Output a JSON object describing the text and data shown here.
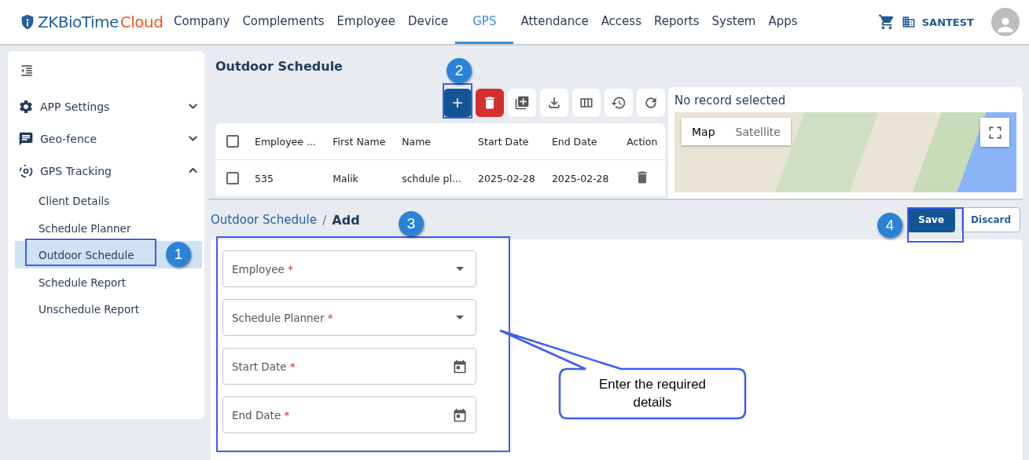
{
  "header": {
    "logo": {
      "brand": "ZKBioTime",
      "suffix": "Cloud"
    },
    "nav": [
      {
        "label": "Company",
        "selected": false
      },
      {
        "label": "Complements",
        "selected": false
      },
      {
        "label": "Employee",
        "selected": false
      },
      {
        "label": "Device",
        "selected": false
      },
      {
        "label": "GPS",
        "selected": true
      },
      {
        "label": "Attendance",
        "selected": false
      },
      {
        "label": "Access",
        "selected": false
      },
      {
        "label": "Reports",
        "selected": false
      },
      {
        "label": "System",
        "selected": false
      },
      {
        "label": "Apps",
        "selected": false
      }
    ],
    "company": "SANTEST"
  },
  "sidebar": {
    "items": [
      {
        "label": "APP Settings",
        "expanded": false
      },
      {
        "label": "Geo-fence",
        "expanded": false
      },
      {
        "label": "GPS Tracking",
        "expanded": true,
        "children": [
          {
            "label": "Client Details",
            "selected": false
          },
          {
            "label": "Schedule Planner",
            "selected": false
          },
          {
            "label": "Outdoor Schedule",
            "selected": true
          },
          {
            "label": "Schedule Report",
            "selected": false
          },
          {
            "label": "Unschedule Report",
            "selected": false
          }
        ]
      }
    ]
  },
  "list": {
    "title": "Outdoor Schedule",
    "table": {
      "select_all_checked": false,
      "columns": [
        "Employee ...",
        "First Name",
        "Name",
        "Start Date",
        "End Date",
        "Action"
      ],
      "rows": [
        {
          "checked": false,
          "cells": [
            "535",
            "Malik",
            "schdule pl...",
            "2025-02-28",
            "2025-02-28"
          ]
        }
      ]
    }
  },
  "map": {
    "status": "No record selected",
    "types": [
      {
        "label": "Map",
        "selected": true
      },
      {
        "label": "Satellite",
        "selected": false
      }
    ]
  },
  "form": {
    "breadcrumb": {
      "parent": "Outdoor Schedule",
      "separator": "/",
      "current": "Add"
    },
    "buttons": [
      {
        "label": "Save",
        "kind": "primary"
      },
      {
        "label": "Discard",
        "kind": "secondary"
      }
    ],
    "fields": [
      {
        "label": "Employee",
        "required_mark": "*",
        "kind": "select"
      },
      {
        "label": "Schedule Planner",
        "required_mark": "*",
        "kind": "select"
      },
      {
        "label": "Start Date",
        "required_mark": "*",
        "kind": "date"
      },
      {
        "label": "End Date",
        "required_mark": "*",
        "kind": "date"
      }
    ]
  },
  "annotations": {
    "steps": [
      {
        "number": "1"
      },
      {
        "number": "2"
      },
      {
        "number": "3"
      },
      {
        "number": "4"
      }
    ],
    "callout": "Enter the required details"
  }
}
